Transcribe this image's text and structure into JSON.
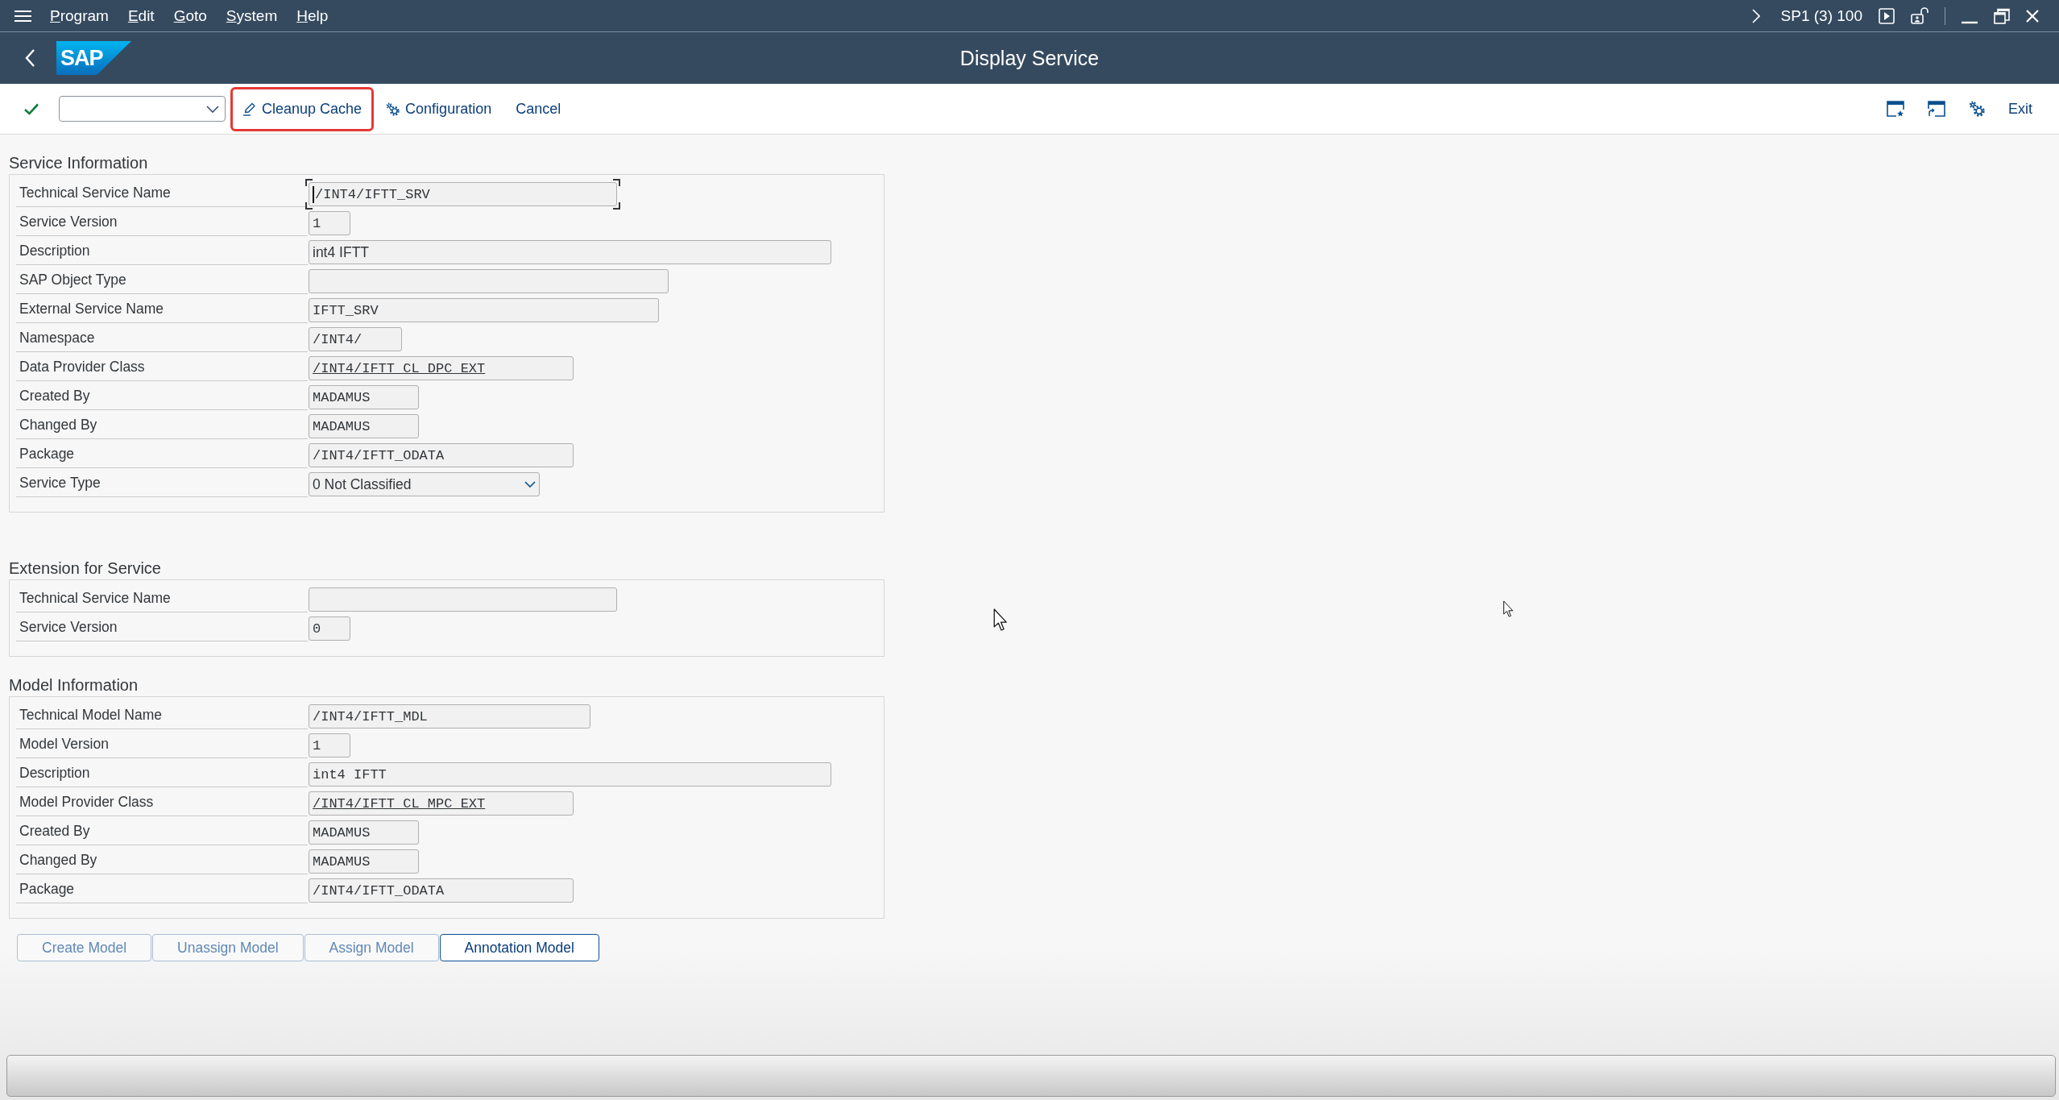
{
  "menu_bar": {
    "items": [
      "Program",
      "Edit",
      "Goto",
      "System",
      "Help"
    ],
    "system_info": "SP1 (3) 100"
  },
  "title_bar": {
    "logo_text": "SAP",
    "title": "Display Service"
  },
  "toolbar": {
    "buttons": [
      {
        "label": "Cleanup Cache",
        "highlighted": true
      },
      {
        "label": "Configuration",
        "highlighted": false
      },
      {
        "label": "Cancel",
        "highlighted": false
      }
    ],
    "exit_button": {
      "label": "Exit"
    }
  },
  "sections": [
    {
      "title": "Service Information",
      "fields": [
        {
          "label": "Technical Service Name",
          "kind": "input",
          "value": "/INT4/IFTT_SRV",
          "focused": true
        },
        {
          "label": "Service Version",
          "kind": "input",
          "value": "1",
          "focused": false
        },
        {
          "label": "Description",
          "kind": "text",
          "value": "int4 IFTT",
          "focused": false
        },
        {
          "label": "SAP Object Type",
          "kind": "input",
          "focused": false
        },
        {
          "label": "External Service Name",
          "kind": "input",
          "value": "IFTT_SRV",
          "focused": false
        },
        {
          "label": "Namespace",
          "kind": "input",
          "value": "/INT4/",
          "focused": false
        },
        {
          "label": "Data Provider Class",
          "kind": "link",
          "value": "/INT4/IFTT_CL_DPC_EXT",
          "focused": false
        },
        {
          "label": "Created By",
          "kind": "input",
          "value": "MADAMUS",
          "focused": false
        },
        {
          "label": "Changed By",
          "kind": "input",
          "value": "MADAMUS",
          "focused": false
        },
        {
          "label": "Package",
          "kind": "input",
          "value": "/INT4/IFTT_ODATA",
          "focused": false
        },
        {
          "label": "Service Type",
          "kind": "dropdown",
          "value": "0 Not Classified",
          "focused": false
        }
      ]
    },
    {
      "title": "Extension for Service",
      "fields": [
        {
          "label": "Technical Service Name",
          "kind": "input",
          "focused": false
        },
        {
          "label": "Service Version",
          "kind": "input",
          "value": "0",
          "focused": false
        }
      ]
    },
    {
      "title": "Model Information",
      "fields": [
        {
          "label": "Technical Model Name",
          "kind": "input",
          "value": "/INT4/IFTT_MDL",
          "focused": false
        },
        {
          "label": "Model Version",
          "kind": "input",
          "value": "1",
          "focused": false
        },
        {
          "label": "Description",
          "kind": "input",
          "value": "int4 IFTT",
          "focused": false
        },
        {
          "label": "Model Provider Class",
          "kind": "link",
          "value": "/INT4/IFTT_CL_MPC_EXT",
          "focused": false
        },
        {
          "label": "Created By",
          "kind": "input",
          "value": "MADAMUS",
          "focused": false
        },
        {
          "label": "Changed By",
          "kind": "input",
          "value": "MADAMUS",
          "focused": false
        },
        {
          "label": "Package",
          "kind": "input",
          "value": "/INT4/IFTT_ODATA",
          "focused": false
        }
      ]
    }
  ],
  "model_buttons": [
    {
      "label": "Create Model",
      "disabled": true
    },
    {
      "label": "Unassign Model",
      "disabled": true
    },
    {
      "label": "Assign Model",
      "disabled": true
    },
    {
      "label": "Annotation Model",
      "disabled": false
    }
  ]
}
